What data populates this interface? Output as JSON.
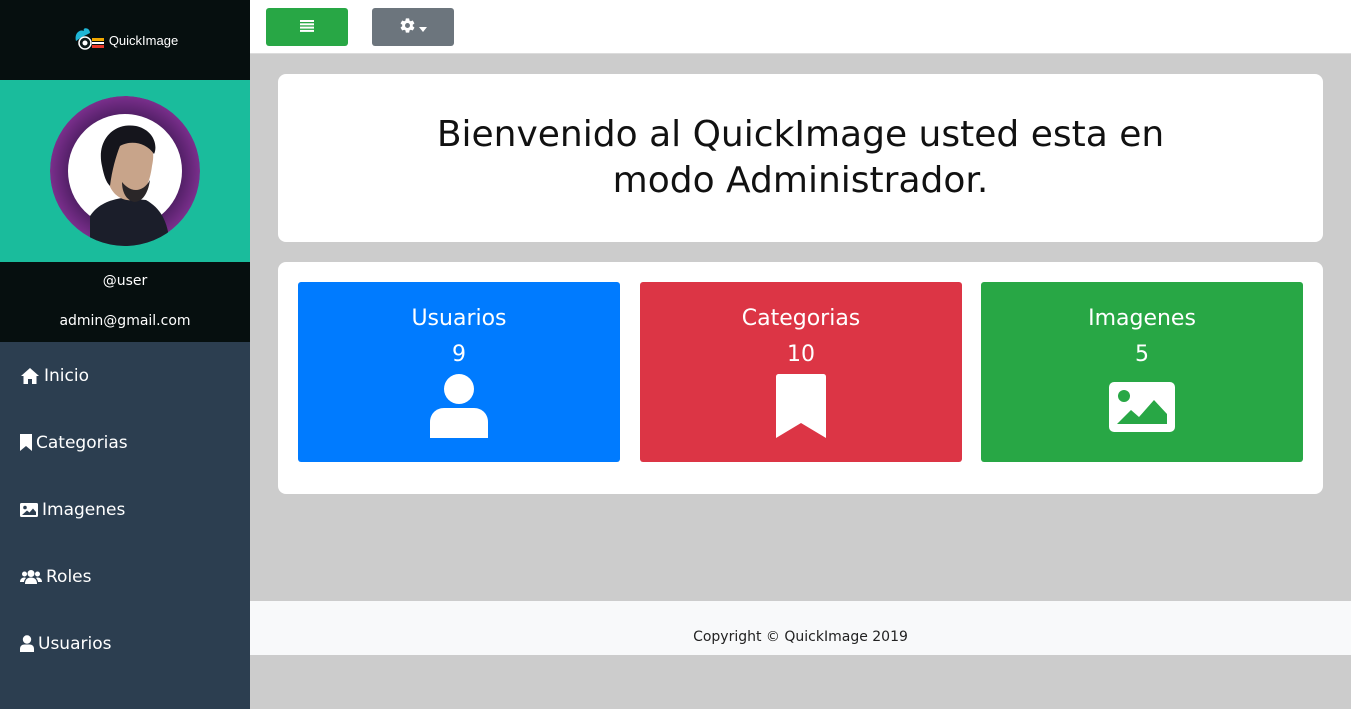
{
  "brand": {
    "name": "QuickImage"
  },
  "profile": {
    "username": "@user",
    "email": "admin@gmail.com"
  },
  "sidebar": {
    "items": [
      {
        "label": "Inicio",
        "icon": "home-icon"
      },
      {
        "label": "Categorias",
        "icon": "bookmark-icon"
      },
      {
        "label": "Imagenes",
        "icon": "image-icon"
      },
      {
        "label": "Roles",
        "icon": "users-icon"
      },
      {
        "label": "Usuarios",
        "icon": "user-icon"
      }
    ]
  },
  "toolbar": {
    "menu_icon": "list-icon",
    "settings_icon": "gear-icon"
  },
  "main": {
    "welcome": "Bienvenido al QuickImage usted esta en modo Administrador.",
    "cards": [
      {
        "title": "Usuarios",
        "count": "9",
        "icon": "user-icon",
        "color": "#007bff"
      },
      {
        "title": "Categorias",
        "count": "10",
        "icon": "bookmark-icon",
        "color": "#dc3545"
      },
      {
        "title": "Imagenes",
        "count": "5",
        "icon": "image-icon",
        "color": "#28a745"
      }
    ]
  },
  "footer": {
    "copyright": "Copyright © QuickImage 2019"
  },
  "colors": {
    "sidebar": "#2c3e50",
    "profile_band": "#1abc9c",
    "dark": "#060f0f",
    "background": "#cccccc"
  }
}
